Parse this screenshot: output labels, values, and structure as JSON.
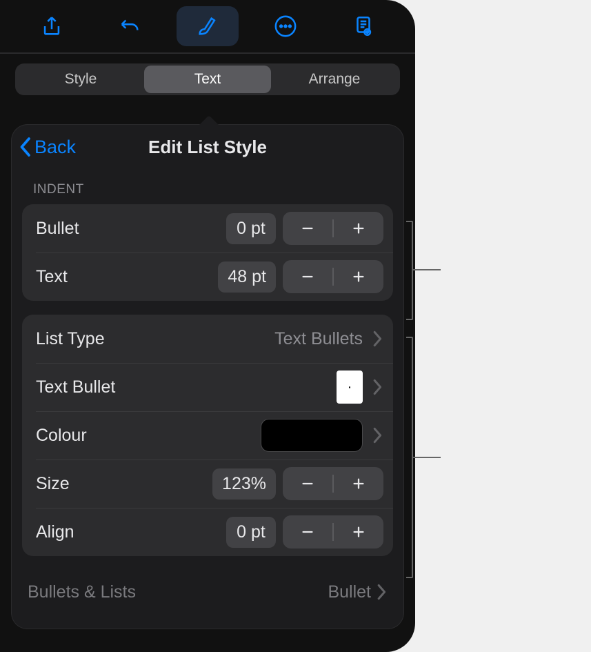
{
  "toolbar": {
    "share_icon": "share",
    "undo_icon": "undo",
    "format_icon": "paintbrush",
    "more_icon": "ellipsis-circle",
    "doc_icon": "doc-view"
  },
  "segmented": {
    "style": "Style",
    "text": "Text",
    "arrange": "Arrange"
  },
  "nav": {
    "back": "Back",
    "title": "Edit List Style"
  },
  "indent": {
    "header": "INDENT",
    "bullet_label": "Bullet",
    "bullet_value": "0 pt",
    "text_label": "Text",
    "text_value": "48 pt"
  },
  "list": {
    "type_label": "List Type",
    "type_value": "Text Bullets",
    "bullet_label": "Text Bullet",
    "bullet_glyph": "·",
    "colour_label": "Colour",
    "size_label": "Size",
    "size_value": "123%",
    "align_label": "Align",
    "align_value": "0 pt"
  },
  "footer": {
    "left": "Bullets & Lists",
    "right": "Bullet"
  }
}
